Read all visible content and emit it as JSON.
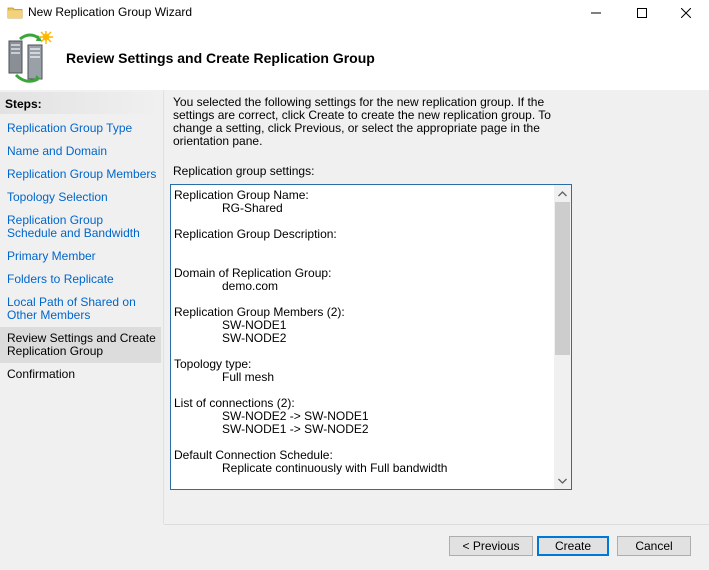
{
  "window": {
    "title": "New Replication Group Wizard"
  },
  "header": {
    "title": "Review Settings and Create Replication Group"
  },
  "steps": {
    "heading": "Steps:",
    "items": [
      {
        "label": "Replication Group Type"
      },
      {
        "label": "Name and Domain"
      },
      {
        "label": "Replication Group Members"
      },
      {
        "label": "Topology Selection"
      },
      {
        "label": "Replication Group Schedule and Bandwidth"
      },
      {
        "label": "Primary Member"
      },
      {
        "label": "Folders to Replicate"
      },
      {
        "label": "Local Path of Shared on Other Members"
      },
      {
        "label": "Review Settings and Create Replication Group"
      },
      {
        "label": "Confirmation"
      }
    ]
  },
  "content": {
    "intro": "You selected the following settings for the new replication group. If the settings are correct, click Create to create the new replication group. To change a setting, click Previous, or select the appropriate page in the orientation pane.",
    "settings_label": "Replication group settings:",
    "settings": {
      "name_label": "Replication Group Name:",
      "name_value": "RG-Shared",
      "description_label": "Replication Group Description:",
      "domain_label": "Domain of Replication Group:",
      "domain_value": "demo.com",
      "members_label": "Replication Group Members (2):",
      "members": [
        "SW-NODE1",
        "SW-NODE2"
      ],
      "topology_label": "Topology type:",
      "topology_value": "Full mesh",
      "connections_label": "List of connections (2):",
      "connections": [
        "SW-NODE2 -> SW-NODE1",
        "SW-NODE1 -> SW-NODE2"
      ],
      "schedule_label": "Default Connection Schedule:",
      "schedule_value": "Replicate continuously with Full bandwidth"
    }
  },
  "buttons": {
    "previous": "< Previous",
    "create": "Create",
    "cancel": "Cancel"
  },
  "icons": {
    "app": "replication-servers-icon",
    "minimize": "minimize-icon",
    "maximize": "maximize-icon",
    "close": "close-icon",
    "scroll_up": "chevron-up-icon",
    "scroll_down": "chevron-down-icon"
  }
}
